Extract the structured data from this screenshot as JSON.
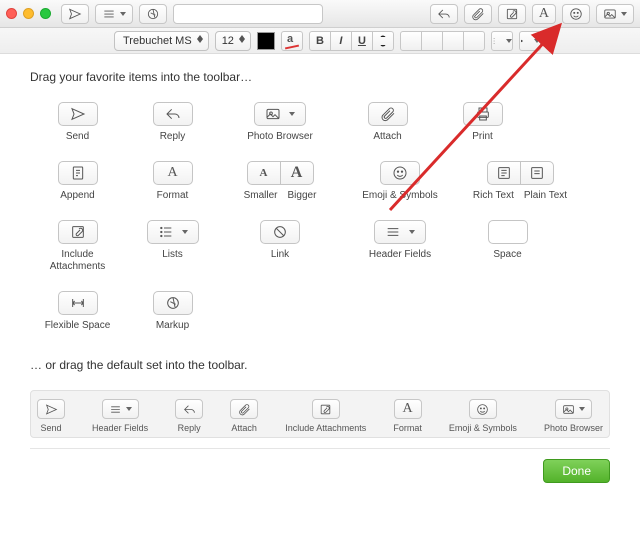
{
  "toolbar1": {
    "send": "send-icon",
    "header": "header-icon",
    "format_circle": "format-icon"
  },
  "fontbar": {
    "font": "Trebuchet MS",
    "size": "12",
    "bold": "B",
    "italic": "I",
    "underline": "U"
  },
  "intro": "Drag your favorite items into the toolbar…",
  "items": {
    "send": "Send",
    "reply": "Reply",
    "photo": "Photo Browser",
    "attach": "Attach",
    "print": "Print",
    "append": "Append",
    "format": "Format",
    "smaller": "Smaller",
    "bigger": "Bigger",
    "emoji": "Emoji & Symbols",
    "rich": "Rich Text",
    "plain": "Plain Text",
    "include": "Include\nAttachments",
    "lists": "Lists",
    "link": "Link",
    "headerfields": "Header Fields",
    "space": "Space",
    "flex": "Flexible Space",
    "markup": "Markup"
  },
  "default_intro": "… or drag the default set into the toolbar.",
  "defaults": {
    "send": "Send",
    "header": "Header Fields",
    "reply": "Reply",
    "attach": "Attach",
    "include": "Include Attachments",
    "format": "Format",
    "emoji": "Emoji & Symbols",
    "photo": "Photo Browser"
  },
  "done": "Done"
}
